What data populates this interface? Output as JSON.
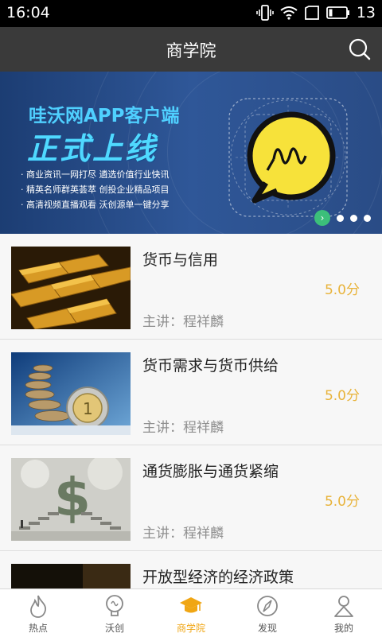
{
  "status_bar": {
    "time": "16:04",
    "battery": "13"
  },
  "header": {
    "title": "商学院"
  },
  "banner": {
    "title": "哇沃网APP客户端",
    "headline": "正式上线",
    "lines": [
      "商业资讯一网打尽  遴选价值行业快讯",
      "精英名师群英荟萃  创投企业精品项目",
      "高清视频直播观看  沃创源单一键分享"
    ],
    "indicator_count": 4,
    "active_index": 0
  },
  "courses": [
    {
      "title": "货币与信用",
      "score": "5.0分",
      "lecturer": "主讲：程祥麟"
    },
    {
      "title": "货币需求与货币供给",
      "score": "5.0分",
      "lecturer": "主讲：程祥麟"
    },
    {
      "title": "通货膨胀与通货紧缩",
      "score": "5.0分",
      "lecturer": "主讲：程祥麟"
    },
    {
      "title": "开放型经济的经济政策",
      "score": "",
      "lecturer": ""
    }
  ],
  "tabs": [
    {
      "label": "热点",
      "icon": "flame-icon"
    },
    {
      "label": "沃创",
      "icon": "lightbulb-icon"
    },
    {
      "label": "商学院",
      "icon": "graduation-cap-icon"
    },
    {
      "label": "发现",
      "icon": "compass-icon"
    },
    {
      "label": "我的",
      "icon": "person-icon"
    }
  ],
  "colors": {
    "accent": "#f0a614",
    "score": "#e8b33a",
    "header": "#3a3a3a"
  }
}
